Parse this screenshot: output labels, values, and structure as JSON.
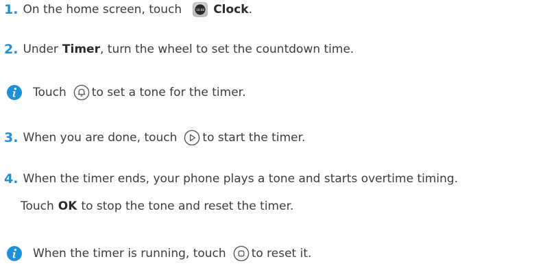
{
  "steps": [
    {
      "num": "1.",
      "pre": "On the home screen, touch",
      "app_icon_text": "10:08",
      "bold": "Clock",
      "post": "."
    },
    {
      "num": "2.",
      "pre": "Under",
      "bold": "Timer",
      "post": ", turn the wheel to set the countdown time."
    },
    {
      "num": "3.",
      "pre": "When you are done, touch",
      "post": "to start the timer."
    },
    {
      "num": "4.",
      "text": "When the timer ends, your phone plays a tone and starts overtime timing.",
      "cont_pre": "Touch",
      "cont_bold": "OK",
      "cont_post": "to stop the tone and reset the timer."
    }
  ],
  "notes": [
    {
      "pre": "Touch",
      "icon": "bell-icon",
      "post": "to set a tone for the timer."
    },
    {
      "pre": "When the timer is running, touch",
      "icon": "stop-icon",
      "post": "to reset it."
    }
  ],
  "colors": {
    "accent": "#1f8fd6",
    "text": "#3c3c3c",
    "icon_stroke": "#555555"
  }
}
